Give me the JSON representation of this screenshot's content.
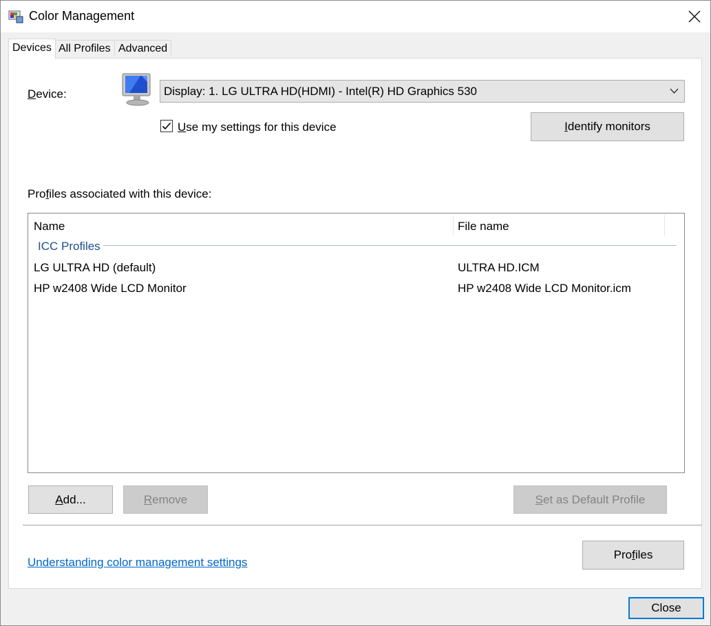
{
  "window": {
    "title": "Color Management"
  },
  "tabs": [
    {
      "label": "Devices"
    },
    {
      "label": "All Profiles"
    },
    {
      "label": "Advanced"
    }
  ],
  "device": {
    "label_pre": "",
    "label_mn": "D",
    "label_rest": "evice:",
    "selected": "Display: 1. LG ULTRA HD(HDMI) - Intel(R) HD Graphics 530",
    "use_settings_mn": "U",
    "use_settings_rest": "se my settings for this device",
    "use_settings_checked": true,
    "identify_mn": "I",
    "identify_rest": "dentify monitors"
  },
  "profiles": {
    "heading_pre": "Pro",
    "heading_mn": "f",
    "heading_rest": "iles associated with this device:",
    "columns": [
      "Name",
      "File name"
    ],
    "group": "ICC Profiles",
    "rows": [
      {
        "name": "LG ULTRA HD (default)",
        "file": "ULTRA HD.ICM"
      },
      {
        "name": "HP w2408 Wide LCD Monitor",
        "file": "HP w2408 Wide LCD Monitor.icm"
      }
    ]
  },
  "buttons": {
    "add_mn": "A",
    "add_rest": "dd...",
    "remove_mn": "R",
    "remove_rest": "emove",
    "set_default_mn": "S",
    "set_default_rest": "et as Default Profile",
    "profiles_pre": "Pro",
    "profiles_mn": "f",
    "profiles_rest": "iles",
    "close": "Close"
  },
  "link": "Understanding color management settings",
  "colors": {
    "accent": "#0078d7",
    "link": "#0066cc"
  }
}
